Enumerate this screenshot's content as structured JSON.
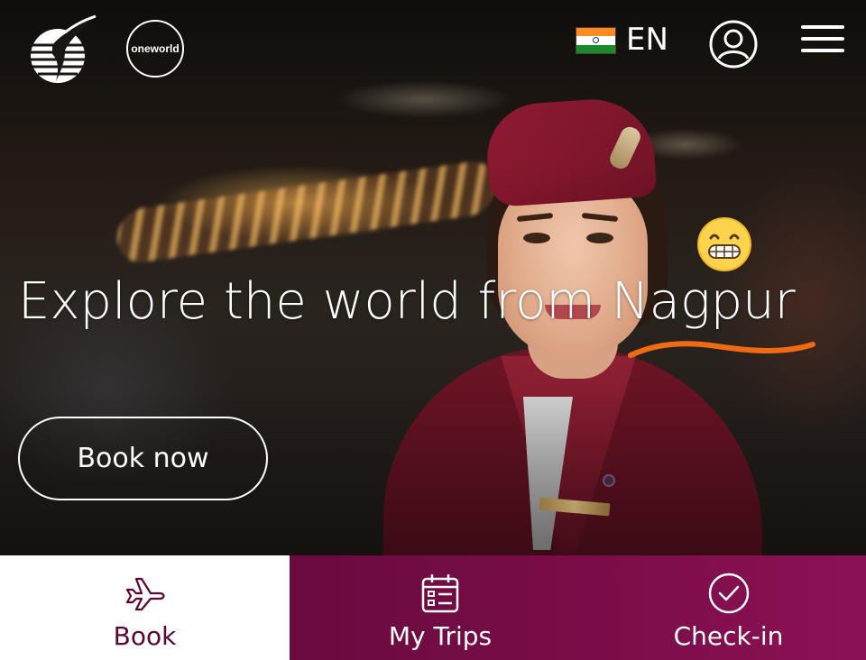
{
  "header": {
    "logo_icon": "oryx-logo-icon",
    "alliance_badge_text": "oneworld",
    "flag_icon": "india-flag-icon",
    "language": "EN",
    "account_icon": "user-icon",
    "menu_icon": "hamburger-menu-icon"
  },
  "hero": {
    "headline": "Explore the world from Nagpur",
    "cta_label": "Book now",
    "annotation_emoji": "grinning-face-emoji",
    "annotation_color": "#f06a14"
  },
  "tabbar": {
    "tabs": [
      {
        "label": "Book",
        "icon": "airplane-icon",
        "active": true
      },
      {
        "label": "My Trips",
        "icon": "calendar-icon",
        "active": false
      },
      {
        "label": "Check-in",
        "icon": "checkmark-circle-icon",
        "active": false
      }
    ]
  },
  "colors": {
    "brand_burgundy": "#5c0632",
    "tab_active_bg": "#ffffff",
    "tab_inactive_bg": "#7a0d49"
  }
}
